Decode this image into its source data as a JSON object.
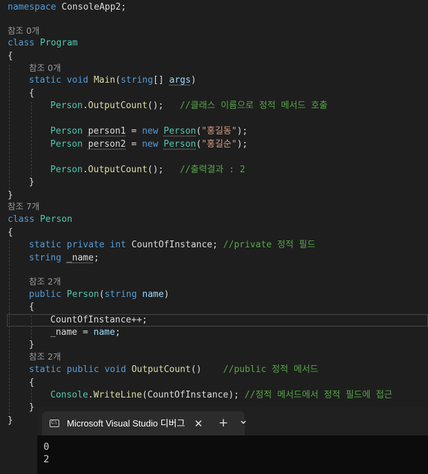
{
  "code": {
    "namespace_kw": "namespace",
    "namespace_name": "ConsoleApp2;",
    "refs_program": "참조 0개",
    "class_kw": "class",
    "program_name": "Program",
    "refs_main": "참조 0개",
    "static_kw": "static",
    "void_kw": "void",
    "main_name": "Main",
    "string_kw": "string",
    "main_params_rest": "[] ",
    "args_name": "args",
    "person_type": "Person",
    "output_count": "OutputCount",
    "comment_class_call": "//클래스 이름으로 정적 메서드 호출",
    "new_kw": "new",
    "person1_var": "person1",
    "person2_var": "person2",
    "str_hong_gildong": "\"홍길동\"",
    "str_hong_gilsun": "\"홍길순\"",
    "comment_output": "//출력결과 : 2",
    "refs_person_class": "참조 7개",
    "private_kw": "private",
    "int_kw": "int",
    "count_field": "CountOfInstance",
    "comment_private_field": "//private 정적 필드",
    "name_field": "_name",
    "refs_ctor": "참조 2개",
    "public_kw": "public",
    "name_param": "name",
    "refs_output": "참조 2개",
    "comment_public_method": "//public 정적 메서드",
    "console_type": "Console",
    "writeline": "WriteLine",
    "comment_access": "//정적 메서드에서 정적 필드에 접근"
  },
  "terminal": {
    "icon_label": "C:\\",
    "tab_title": "Microsoft Visual Studio 디버그",
    "close_icon": "✕",
    "new_tab_icon": "+",
    "dropdown_icon": "⌄",
    "output_lines": [
      "0",
      "2"
    ]
  }
}
